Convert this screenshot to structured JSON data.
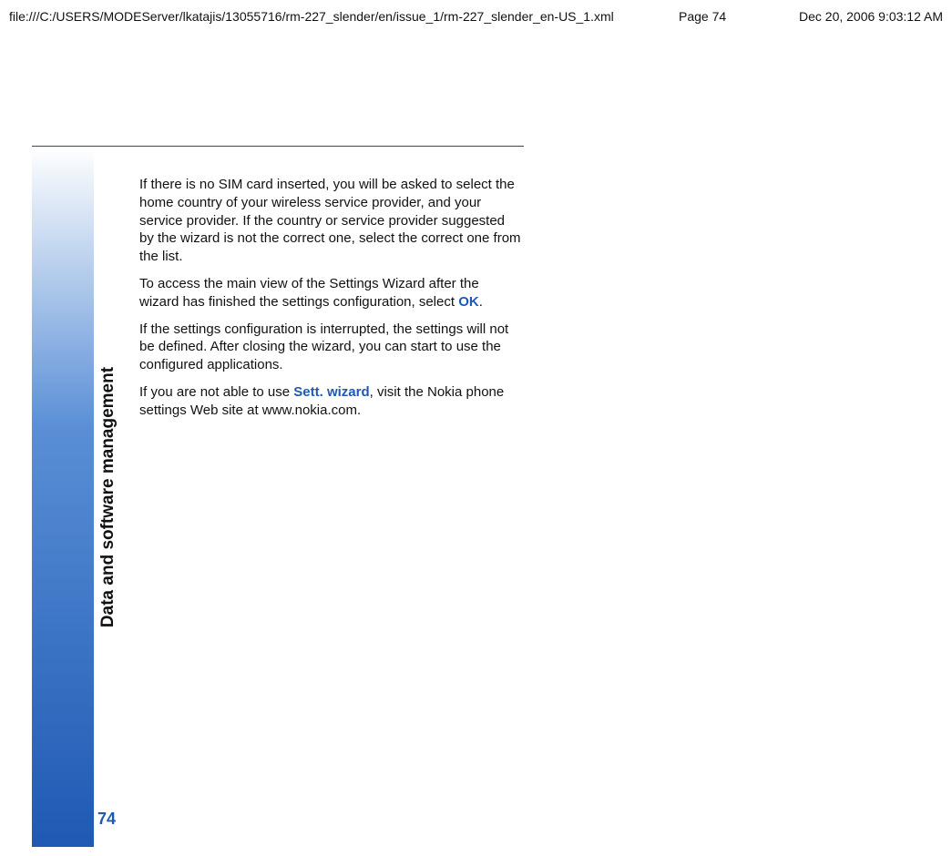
{
  "header": {
    "path": "file:///C:/USERS/MODEServer/lkatajis/13055716/rm-227_slender/en/issue_1/rm-227_slender_en-US_1.xml",
    "page": "Page 74",
    "date": "Dec 20, 2006 9:03:12 AM"
  },
  "side_title": "Data and software management",
  "page_number": "74",
  "paragraphs": {
    "p1": "If there is no SIM card inserted, you will be asked to select the home country of your wireless service provider, and your service provider. If the country or service provider suggested by the wizard is not the correct one, select the correct one from the list.",
    "p2_a": "To access the main view of the Settings Wizard after the wizard has finished the settings configuration, select ",
    "p2_ok": "OK",
    "p2_b": ".",
    "p3": "If the settings configuration is interrupted, the settings will not be defined. After closing the wizard, you can start to use the configured applications.",
    "p4_a": "If you are not able to use ",
    "p4_sett": "Sett. wizard",
    "p4_b": ", visit the Nokia phone settings Web site at www.nokia.com."
  }
}
